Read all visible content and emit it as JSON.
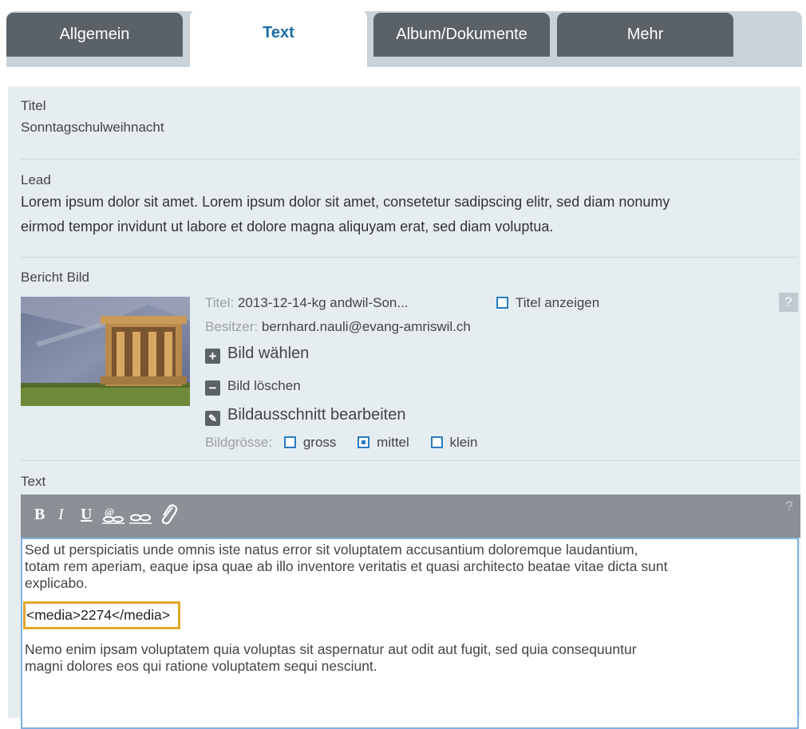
{
  "tabs": [
    {
      "label": "Allgemein",
      "active": false
    },
    {
      "label": "Text",
      "active": true
    },
    {
      "label": "Album/Dokumente",
      "active": false
    },
    {
      "label": "Mehr",
      "active": false
    }
  ],
  "colors": {
    "accent": "#1a6ea6",
    "tab_inactive": "#5a6268",
    "panel_bg": "#e6edf0",
    "highlight": "#e2a72a"
  },
  "titel": {
    "label": "Titel",
    "value": "Sonntagschulweihnacht"
  },
  "lead": {
    "label": "Lead",
    "line1": "Lorem ipsum dolor sit amet. Lorem ipsum dolor sit amet, consetetur sadipscing elitr, sed diam nonumy",
    "line2": "eirmod tempor invidunt ut labore et dolore magna aliquyam erat, sed diam voluptua."
  },
  "bild": {
    "label": "Bericht Bild",
    "titel_key": "Titel:",
    "titel_value": "2013-12-14-kg andwil-Son...",
    "show_title_label": "Titel anzeigen",
    "show_title_checked": false,
    "owner_key": "Besitzer:",
    "owner_value": "bernhard.nauli@evang-amriswil.ch",
    "choose_label": "Bild wählen",
    "delete_label": "Bild löschen",
    "crop_label": "Bildausschnitt bearbeiten",
    "size_key": "Bildgrösse:",
    "sizes": [
      {
        "label": "gross",
        "checked": false
      },
      {
        "label": "mittel",
        "checked": true
      },
      {
        "label": "klein",
        "checked": false
      }
    ],
    "help": "?"
  },
  "text": {
    "label": "Text",
    "help": "?",
    "toolbar": [
      "B",
      "I",
      "U"
    ],
    "toolbar_icons": [
      "bold-icon",
      "italic-icon",
      "underline-icon",
      "link-icon",
      "unlink-icon",
      "paperclip-icon"
    ],
    "para1_l1": "Sed ut perspiciatis unde omnis iste natus error sit voluptatem accusantium doloremque laudantium,",
    "para1_l2": "totam rem aperiam, eaque ipsa quae ab illo inventore veritatis et quasi architecto beatae vitae dicta sunt",
    "para1_l3": "explicabo.",
    "media_tag": "<media>2274</media>",
    "para2_l1": "Nemo enim ipsam voluptatem quia voluptas sit aspernatur aut odit aut fugit, sed quia consequuntur",
    "para2_l2": "magni dolores eos qui ratione voluptatem sequi nesciunt."
  }
}
